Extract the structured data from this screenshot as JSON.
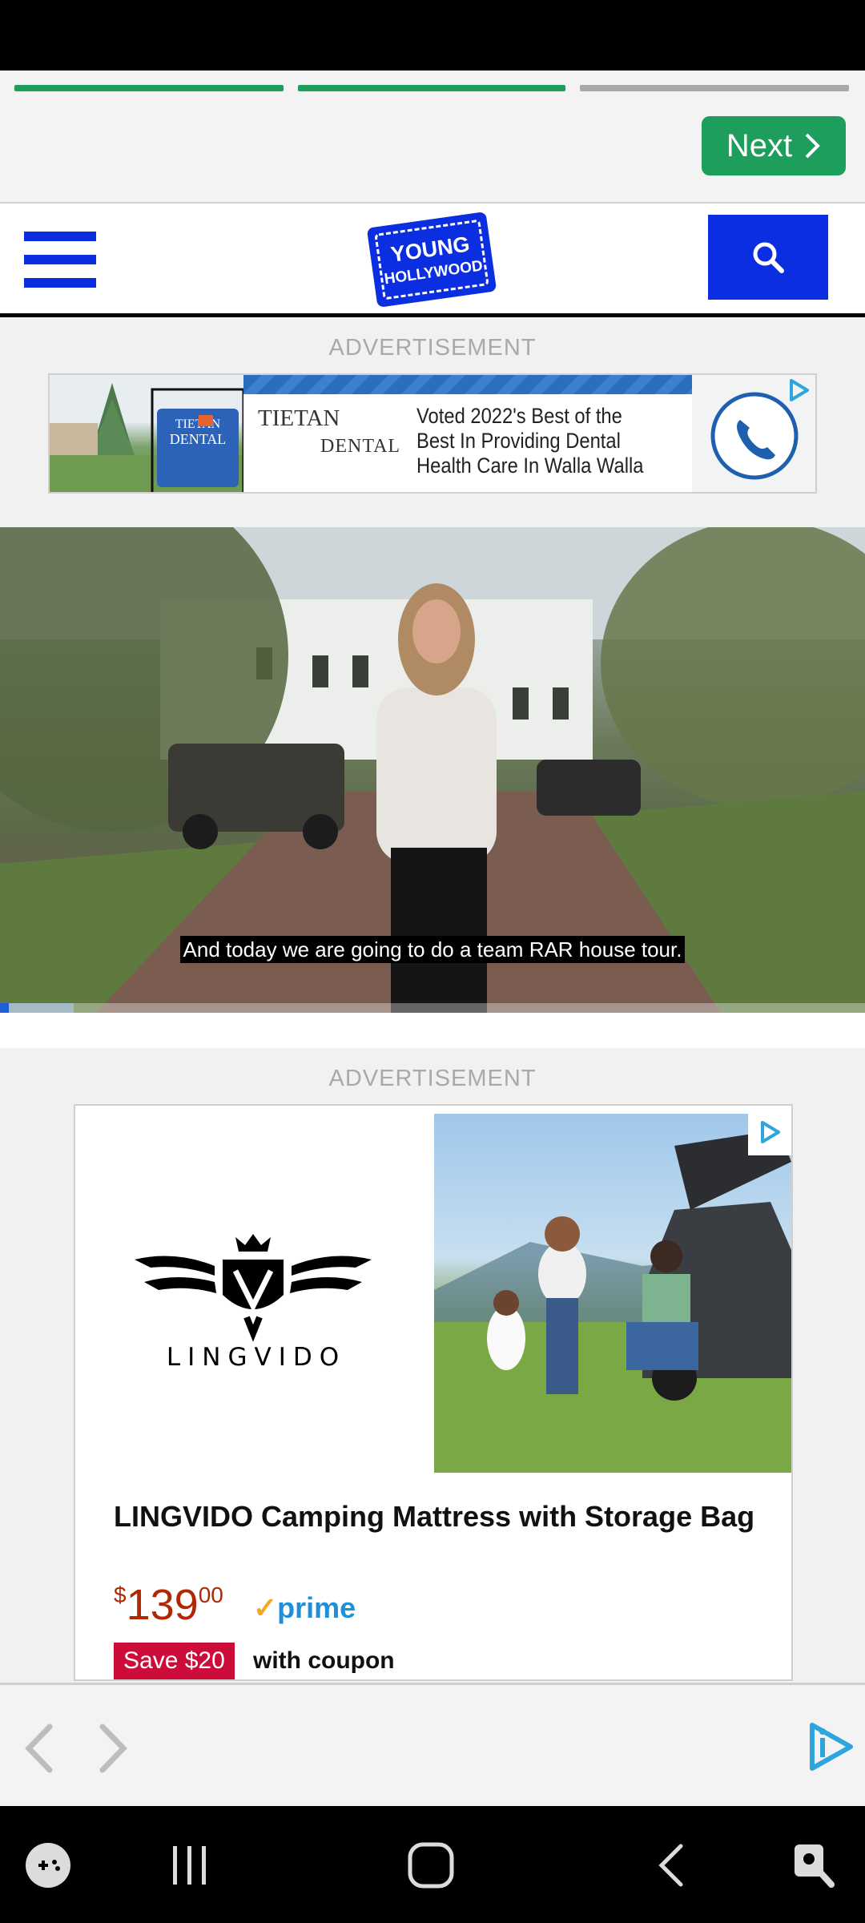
{
  "story": {
    "next_label": "Next",
    "segments": [
      {
        "state": "done",
        "color": "#1e9e5c"
      },
      {
        "state": "done",
        "color": "#1e9e5c"
      },
      {
        "state": "pending",
        "color": "#aaaaaa"
      }
    ]
  },
  "header": {
    "logo_line1": "YOUNG",
    "logo_line2": "HOLLYWOOD",
    "accent_color": "#0b2fe0"
  },
  "ads": {
    "label": "ADVERTISEMENT",
    "dental": {
      "photo_sign_line1": "TIETAN",
      "photo_sign_line2": "DENTAL",
      "brand_line1": "TIETAN",
      "brand_line2": "DENTAL",
      "copy": "Voted 2022's Best of the Best In Providing Dental Health Care In Walla Walla",
      "call_icon": "phone-icon"
    },
    "product": {
      "brand": "LINGVIDO",
      "title": "LINGVIDO Camping Mattress with Storage Bag",
      "price_currency": "$",
      "price_whole": "139",
      "price_fraction": "00",
      "prime_label": "prime",
      "save_badge": "Save $20",
      "coupon_text": "with coupon"
    }
  },
  "video": {
    "caption": "And today we are going to do a team RAR house tour.",
    "progress_fraction": 0.085
  },
  "ad_nav": {
    "prev_icon": "chevron-left-icon",
    "next_icon": "chevron-right-icon",
    "brand_icon": "adsense-play-icon"
  },
  "system_nav": [
    "game-launcher-icon",
    "recent-apps-icon",
    "home-icon",
    "back-icon",
    "accessibility-icon"
  ]
}
